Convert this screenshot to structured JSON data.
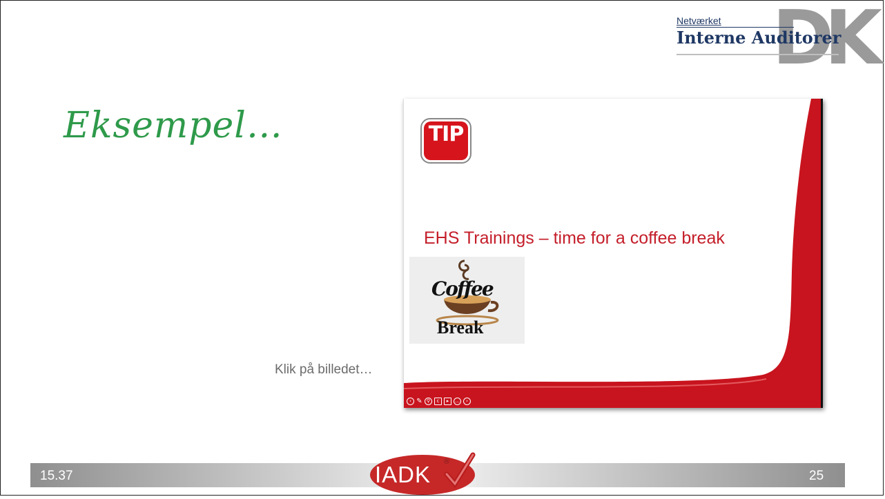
{
  "logo": {
    "network_label": "Netværket",
    "name": "Interne Auditorer",
    "mark": "DK"
  },
  "slide_title": "Eksempel…",
  "hint_text": "Klik på billedet…",
  "embedded_slide": {
    "tip_badge": "TIP",
    "heading": "EHS Trainings – time for a coffee break",
    "image_word_top": "Coffee",
    "image_word_bottom": "Break",
    "player_controls": [
      "prev-icon",
      "pen-icon",
      "zoom-icon",
      "captions-icon",
      "video-icon",
      "more-icon",
      "next-icon"
    ],
    "accent_color": "#c8141e"
  },
  "footer": {
    "time": "15.37",
    "page_number": "25",
    "brand": "IADK",
    "registered": "®",
    "brand_color": "#c62828"
  }
}
